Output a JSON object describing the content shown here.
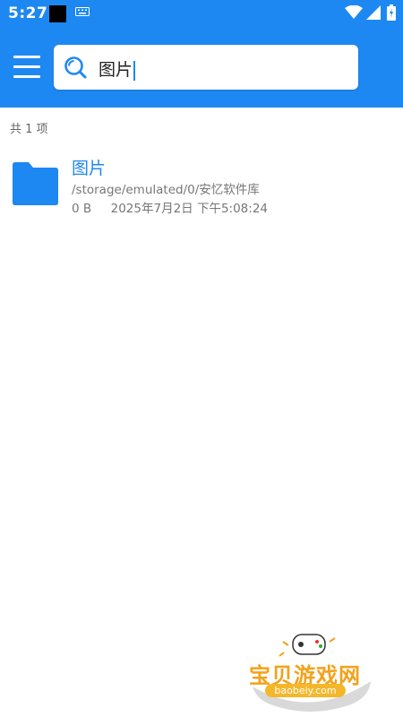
{
  "status_bar": {
    "time": "5:27",
    "icons": [
      "notification-square-icon",
      "keyboard-icon",
      "wifi-icon",
      "signal-icon",
      "battery-icon"
    ]
  },
  "header": {
    "menu_icon": "menu-icon",
    "search": {
      "icon": "search-icon",
      "value": "图片"
    }
  },
  "results": {
    "count_label": "共 1 项",
    "items": [
      {
        "icon": "folder-icon",
        "name": "图片",
        "path": "/storage/emulated/0/安忆软件库",
        "size": "0 B",
        "modified": "2025年7月2日 下午5:08:24"
      }
    ]
  },
  "watermark": {
    "title": "宝贝游戏网",
    "url": "baobeiy.com"
  },
  "colors": {
    "accent": "#1e88f2",
    "watermark": "#f2a21a"
  }
}
